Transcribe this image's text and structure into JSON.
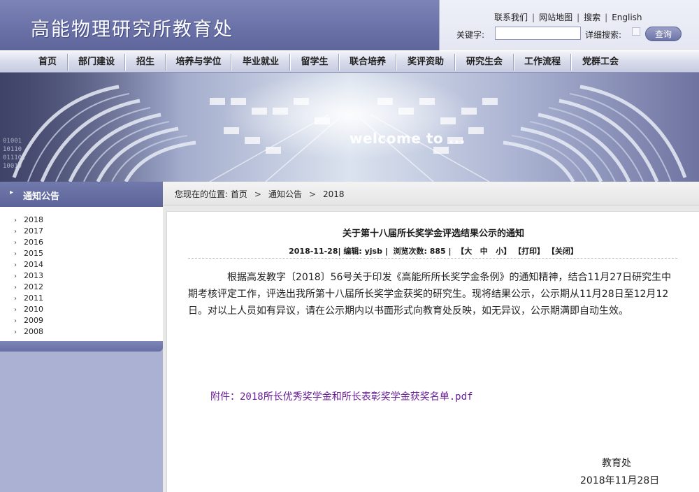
{
  "header": {
    "site_title": "高能物理研究所教育处",
    "top_links": [
      "联系我们",
      "网站地图",
      "搜索",
      "English"
    ],
    "keyword_label": "关键字:",
    "keyword_value": "",
    "advanced_search_label": "详细搜索:",
    "search_button": "查询"
  },
  "nav": {
    "items": [
      "首页",
      "部门建设",
      "招生",
      "培养与学位",
      "毕业就业",
      "留学生",
      "联合培养",
      "奖评资助",
      "研究生会",
      "工作流程",
      "党群工会"
    ]
  },
  "banner": {
    "welcome_text": "welcome to ..."
  },
  "sidebar": {
    "title": "通知公告",
    "years": [
      "2018",
      "2017",
      "2016",
      "2015",
      "2014",
      "2013",
      "2012",
      "2011",
      "2010",
      "2009",
      "2008"
    ]
  },
  "breadcrumb": {
    "prefix": "您现在的位置:",
    "items": [
      "首页",
      "通知公告",
      "2018"
    ]
  },
  "article": {
    "title": "关于第十八届所长奖学金评选结果公示的通知",
    "date": "2018-11-28",
    "editor": "编辑: yjsb",
    "views": "浏览次数: 885",
    "font_sizes": [
      "大",
      "中",
      "小"
    ],
    "print": "打印",
    "close": "关闭",
    "body": "根据高发教字〔2018〕56号关于印发《高能所所长奖学金条例》的通知精神，结合11月27日研究生中期考核评定工作，评选出我所第十八届所长奖学金获奖的研究生。现将结果公示，公示期从11月28日至12月12日。对以上人员如有异议，请在公示期内以书面形式向教育处反映，如无异议，公示期满即自动生效。",
    "attachment": "附件：2018所长优秀奖学金和所长表彰奖学金获奖名单.pdf",
    "signature_dept": "教育处",
    "signature_date": "2018年11月28日"
  },
  "colors": {
    "header_blue": "#6b72a8",
    "sidebar_blue": "#aab1d3",
    "attachment_purple": "#6a1f9a"
  }
}
